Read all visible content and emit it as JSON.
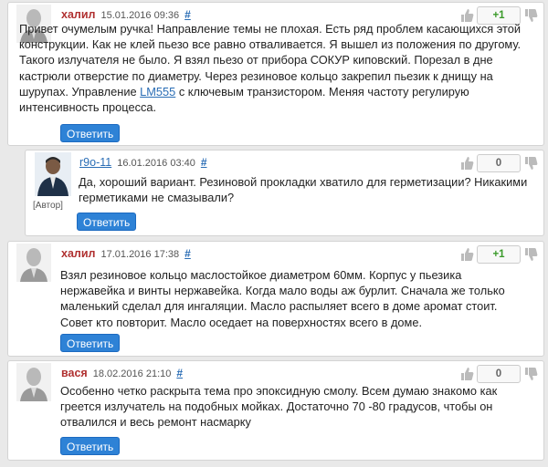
{
  "colors": {
    "author": "#b03030",
    "link": "#2a6db5",
    "button": "#2e82d6",
    "positive": "#3a9a2a"
  },
  "comments": [
    {
      "author": "халил",
      "time": "15.01.2016 09:36",
      "hash": "#",
      "votes": "+1",
      "text_before": "Привет очумелым ручка! Направление темы не плохая. Есть ряд проблем касающихся этой конструкции. Как не клей пьезо все равно отваливается. Я вышел из положения по другому. Такого излучателя не было. Я взял пьезо от прибора СОКУР киповский. Порезал в дне кастрюли отверстие по диаметру. Через резиновое кольцо закрепил пьезик к днищу на шурупах. Управление ",
      "link": "LM555",
      "text_after": " с ключевым транзистором. Меняя частоту регулирую интенсивность процесса.",
      "reply": "Ответить"
    },
    {
      "author": "r9o-11",
      "time": "16.01.2016 03:40",
      "hash": "#",
      "role": "[Автор]",
      "votes": "0",
      "text": "Да, хороший вариант. Резиновой прокладки хватило для герметизации? Никакими герметиками не смазывали?",
      "reply": "Ответить"
    },
    {
      "author": "халил",
      "time": "17.01.2016 17:38",
      "hash": "#",
      "votes": "+1",
      "text": "Взял резиновое кольцо маслостойкое диаметром 60мм. Корпус у пьезика нержавейка и винты нержавейка. Когда мало воды аж бурлит. Сначала жe только маленький сделал для ингаляции. Масло распыляет всего в доме аромат стоит. Совет кто повторит. Масло оседает на поверхностях всего в доме.",
      "reply": "Ответить"
    },
    {
      "author": "вася",
      "time": "18.02.2016 21:10",
      "hash": "#",
      "votes": "0",
      "text": "Особенно четко раскрыта тема про эпоксидную смолу. Всем думаю знакомо как греется излучатель на подобных мойках. Достаточно 70 -80 градусов, чтобы он отвалился и весь ремонт насмарку",
      "reply": "Ответить"
    }
  ]
}
